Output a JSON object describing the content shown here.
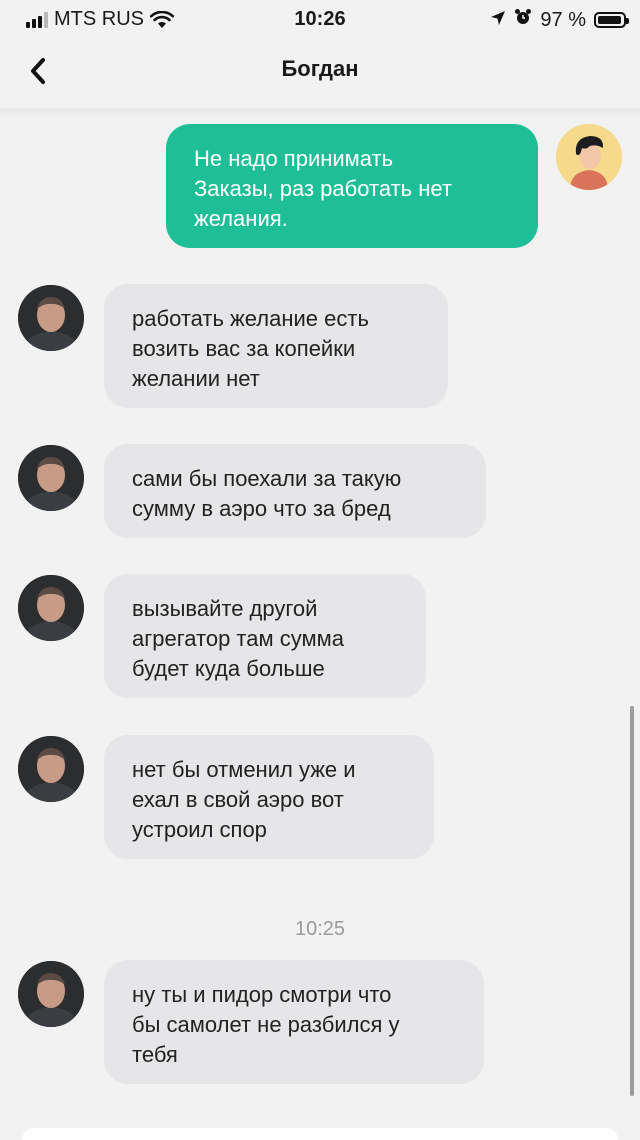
{
  "status": {
    "carrier": "MTS RUS",
    "time": "10:26",
    "battery": "97 %",
    "battery_level": 0.97,
    "signal_bars": 3
  },
  "header": {
    "title": "Богдан"
  },
  "messages": [
    {
      "side": "out",
      "lines": [
        "Не надо принимать",
        "Заказы, раз работать нет",
        "желания."
      ]
    },
    {
      "side": "in",
      "lines": [
        "работать желание есть",
        "возить вас за копейки",
        "желании нет"
      ]
    },
    {
      "side": "in",
      "lines": [
        "сами бы поехали за такую",
        "сумму в аэро что за бред"
      ]
    },
    {
      "side": "in",
      "lines": [
        "вызывайте другой",
        "агрегатор там сумма",
        "будет куда больше"
      ]
    },
    {
      "side": "in",
      "lines": [
        "нет бы отменил уже и",
        "ехал в свой аэро вот",
        "устроил спор"
      ]
    },
    {
      "side": "in",
      "lines": [
        "ну ты и пидор смотри что",
        "бы самолет не разбился у",
        "тебя"
      ]
    }
  ],
  "timestamp": "10:25",
  "colors": {
    "outgoing_bubble": "#1ebf96",
    "incoming_bubble": "#e6e6e8",
    "background": "#f2f2f3"
  }
}
